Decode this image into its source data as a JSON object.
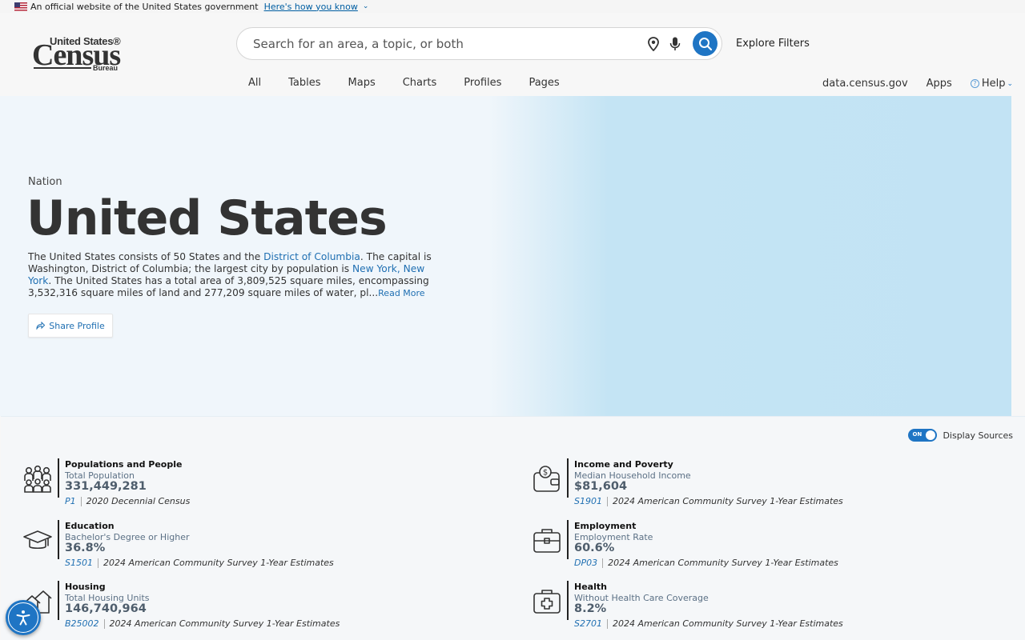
{
  "gov_banner": {
    "text": "An official website of the United States government",
    "link": "Here's how you know"
  },
  "logo": {
    "line1": "United States®",
    "line2": "Census",
    "line3": "Bureau"
  },
  "search": {
    "placeholder": "Search for an area, a topic, or both",
    "value": ""
  },
  "explore_filters": "Explore Filters",
  "nav_tabs": [
    "All",
    "Tables",
    "Maps",
    "Charts",
    "Profiles",
    "Pages"
  ],
  "util_nav": {
    "data": "data.census.gov",
    "apps": "Apps",
    "help": "Help"
  },
  "hero": {
    "kicker": "Nation",
    "title": "United States",
    "desc_1": "The United States consists of 50 States and the ",
    "desc_link_1": "District of Columbia",
    "desc_2": ". The capital is Washington, District of Columbia; the largest city by population is ",
    "desc_link_2": "New York, New York",
    "desc_3": ". The United States has a total area of 3,809,525 square miles, encompassing 3,532,316 square miles of land and 277,209 square miles of water, pl...",
    "read_more": "Read More",
    "share": "Share Profile"
  },
  "display_sources": {
    "toggle_state": "ON",
    "label": "Display Sources"
  },
  "stats": [
    {
      "category": "Populations and People",
      "metric": "Total Population",
      "value": "331,449,281",
      "code": "P1",
      "source": "2020 Decennial Census",
      "icon": "people-icon"
    },
    {
      "category": "Income and Poverty",
      "metric": "Median Household Income",
      "value": "$81,604",
      "code": "S1901",
      "source": "2024 American Community Survey 1-Year Estimates",
      "icon": "wallet-dollar-icon"
    },
    {
      "category": "Education",
      "metric": "Bachelor's Degree or Higher",
      "value": "36.8%",
      "code": "S1501",
      "source": "2024 American Community Survey 1-Year Estimates",
      "icon": "graduation-cap-icon"
    },
    {
      "category": "Employment",
      "metric": "Employment Rate",
      "value": "60.6%",
      "code": "DP03",
      "source": "2024 American Community Survey 1-Year Estimates",
      "icon": "briefcase-icon"
    },
    {
      "category": "Housing",
      "metric": "Total Housing Units",
      "value": "146,740,964",
      "code": "B25002",
      "source": "2024 American Community Survey 1-Year Estimates",
      "icon": "houses-icon"
    },
    {
      "category": "Health",
      "metric": "Without Health Care Coverage",
      "value": "8.2%",
      "code": "S2701",
      "source": "2024 American Community Survey 1-Year Estimates",
      "icon": "medical-kit-icon"
    }
  ],
  "colors": {
    "accent": "#1f75c4",
    "link": "#1f6fb2",
    "hero_left": "#f0f6fb",
    "hero_right": "#c2e3f4"
  }
}
